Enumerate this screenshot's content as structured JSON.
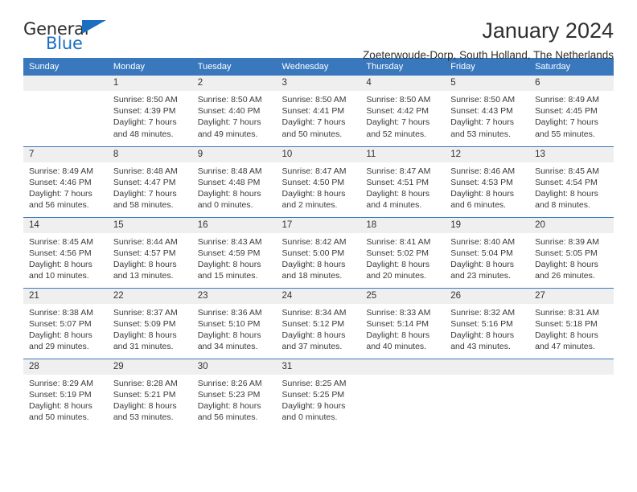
{
  "logo": {
    "word_one": "General",
    "word_two": "Blue",
    "triangle_color": "#1b6fc1",
    "text_color": "#2b2b2b"
  },
  "header": {
    "title": "January 2024",
    "subtitle": "Zoeterwoude-Dorp, South Holland, The Netherlands"
  },
  "colors": {
    "header_blue": "#3a78be",
    "daynum_band": "#efefef",
    "text": "#3a3a3a"
  },
  "weekday_headers": [
    "Sunday",
    "Monday",
    "Tuesday",
    "Wednesday",
    "Thursday",
    "Friday",
    "Saturday"
  ],
  "weeks": [
    [
      {
        "day": "",
        "sunrise": "",
        "sunset": "",
        "daylight_line1": "",
        "daylight_line2": "",
        "blank": true
      },
      {
        "day": "1",
        "sunrise": "Sunrise: 8:50 AM",
        "sunset": "Sunset: 4:39 PM",
        "daylight_line1": "Daylight: 7 hours",
        "daylight_line2": "and 48 minutes."
      },
      {
        "day": "2",
        "sunrise": "Sunrise: 8:50 AM",
        "sunset": "Sunset: 4:40 PM",
        "daylight_line1": "Daylight: 7 hours",
        "daylight_line2": "and 49 minutes."
      },
      {
        "day": "3",
        "sunrise": "Sunrise: 8:50 AM",
        "sunset": "Sunset: 4:41 PM",
        "daylight_line1": "Daylight: 7 hours",
        "daylight_line2": "and 50 minutes."
      },
      {
        "day": "4",
        "sunrise": "Sunrise: 8:50 AM",
        "sunset": "Sunset: 4:42 PM",
        "daylight_line1": "Daylight: 7 hours",
        "daylight_line2": "and 52 minutes."
      },
      {
        "day": "5",
        "sunrise": "Sunrise: 8:50 AM",
        "sunset": "Sunset: 4:43 PM",
        "daylight_line1": "Daylight: 7 hours",
        "daylight_line2": "and 53 minutes."
      },
      {
        "day": "6",
        "sunrise": "Sunrise: 8:49 AM",
        "sunset": "Sunset: 4:45 PM",
        "daylight_line1": "Daylight: 7 hours",
        "daylight_line2": "and 55 minutes."
      }
    ],
    [
      {
        "day": "7",
        "sunrise": "Sunrise: 8:49 AM",
        "sunset": "Sunset: 4:46 PM",
        "daylight_line1": "Daylight: 7 hours",
        "daylight_line2": "and 56 minutes."
      },
      {
        "day": "8",
        "sunrise": "Sunrise: 8:48 AM",
        "sunset": "Sunset: 4:47 PM",
        "daylight_line1": "Daylight: 7 hours",
        "daylight_line2": "and 58 minutes."
      },
      {
        "day": "9",
        "sunrise": "Sunrise: 8:48 AM",
        "sunset": "Sunset: 4:48 PM",
        "daylight_line1": "Daylight: 8 hours",
        "daylight_line2": "and 0 minutes."
      },
      {
        "day": "10",
        "sunrise": "Sunrise: 8:47 AM",
        "sunset": "Sunset: 4:50 PM",
        "daylight_line1": "Daylight: 8 hours",
        "daylight_line2": "and 2 minutes."
      },
      {
        "day": "11",
        "sunrise": "Sunrise: 8:47 AM",
        "sunset": "Sunset: 4:51 PM",
        "daylight_line1": "Daylight: 8 hours",
        "daylight_line2": "and 4 minutes."
      },
      {
        "day": "12",
        "sunrise": "Sunrise: 8:46 AM",
        "sunset": "Sunset: 4:53 PM",
        "daylight_line1": "Daylight: 8 hours",
        "daylight_line2": "and 6 minutes."
      },
      {
        "day": "13",
        "sunrise": "Sunrise: 8:45 AM",
        "sunset": "Sunset: 4:54 PM",
        "daylight_line1": "Daylight: 8 hours",
        "daylight_line2": "and 8 minutes."
      }
    ],
    [
      {
        "day": "14",
        "sunrise": "Sunrise: 8:45 AM",
        "sunset": "Sunset: 4:56 PM",
        "daylight_line1": "Daylight: 8 hours",
        "daylight_line2": "and 10 minutes."
      },
      {
        "day": "15",
        "sunrise": "Sunrise: 8:44 AM",
        "sunset": "Sunset: 4:57 PM",
        "daylight_line1": "Daylight: 8 hours",
        "daylight_line2": "and 13 minutes."
      },
      {
        "day": "16",
        "sunrise": "Sunrise: 8:43 AM",
        "sunset": "Sunset: 4:59 PM",
        "daylight_line1": "Daylight: 8 hours",
        "daylight_line2": "and 15 minutes."
      },
      {
        "day": "17",
        "sunrise": "Sunrise: 8:42 AM",
        "sunset": "Sunset: 5:00 PM",
        "daylight_line1": "Daylight: 8 hours",
        "daylight_line2": "and 18 minutes."
      },
      {
        "day": "18",
        "sunrise": "Sunrise: 8:41 AM",
        "sunset": "Sunset: 5:02 PM",
        "daylight_line1": "Daylight: 8 hours",
        "daylight_line2": "and 20 minutes."
      },
      {
        "day": "19",
        "sunrise": "Sunrise: 8:40 AM",
        "sunset": "Sunset: 5:04 PM",
        "daylight_line1": "Daylight: 8 hours",
        "daylight_line2": "and 23 minutes."
      },
      {
        "day": "20",
        "sunrise": "Sunrise: 8:39 AM",
        "sunset": "Sunset: 5:05 PM",
        "daylight_line1": "Daylight: 8 hours",
        "daylight_line2": "and 26 minutes."
      }
    ],
    [
      {
        "day": "21",
        "sunrise": "Sunrise: 8:38 AM",
        "sunset": "Sunset: 5:07 PM",
        "daylight_line1": "Daylight: 8 hours",
        "daylight_line2": "and 29 minutes."
      },
      {
        "day": "22",
        "sunrise": "Sunrise: 8:37 AM",
        "sunset": "Sunset: 5:09 PM",
        "daylight_line1": "Daylight: 8 hours",
        "daylight_line2": "and 31 minutes."
      },
      {
        "day": "23",
        "sunrise": "Sunrise: 8:36 AM",
        "sunset": "Sunset: 5:10 PM",
        "daylight_line1": "Daylight: 8 hours",
        "daylight_line2": "and 34 minutes."
      },
      {
        "day": "24",
        "sunrise": "Sunrise: 8:34 AM",
        "sunset": "Sunset: 5:12 PM",
        "daylight_line1": "Daylight: 8 hours",
        "daylight_line2": "and 37 minutes."
      },
      {
        "day": "25",
        "sunrise": "Sunrise: 8:33 AM",
        "sunset": "Sunset: 5:14 PM",
        "daylight_line1": "Daylight: 8 hours",
        "daylight_line2": "and 40 minutes."
      },
      {
        "day": "26",
        "sunrise": "Sunrise: 8:32 AM",
        "sunset": "Sunset: 5:16 PM",
        "daylight_line1": "Daylight: 8 hours",
        "daylight_line2": "and 43 minutes."
      },
      {
        "day": "27",
        "sunrise": "Sunrise: 8:31 AM",
        "sunset": "Sunset: 5:18 PM",
        "daylight_line1": "Daylight: 8 hours",
        "daylight_line2": "and 47 minutes."
      }
    ],
    [
      {
        "day": "28",
        "sunrise": "Sunrise: 8:29 AM",
        "sunset": "Sunset: 5:19 PM",
        "daylight_line1": "Daylight: 8 hours",
        "daylight_line2": "and 50 minutes."
      },
      {
        "day": "29",
        "sunrise": "Sunrise: 8:28 AM",
        "sunset": "Sunset: 5:21 PM",
        "daylight_line1": "Daylight: 8 hours",
        "daylight_line2": "and 53 minutes."
      },
      {
        "day": "30",
        "sunrise": "Sunrise: 8:26 AM",
        "sunset": "Sunset: 5:23 PM",
        "daylight_line1": "Daylight: 8 hours",
        "daylight_line2": "and 56 minutes."
      },
      {
        "day": "31",
        "sunrise": "Sunrise: 8:25 AM",
        "sunset": "Sunset: 5:25 PM",
        "daylight_line1": "Daylight: 9 hours",
        "daylight_line2": "and 0 minutes."
      },
      {
        "day": "",
        "sunrise": "",
        "sunset": "",
        "daylight_line1": "",
        "daylight_line2": "",
        "blank": true
      },
      {
        "day": "",
        "sunrise": "",
        "sunset": "",
        "daylight_line1": "",
        "daylight_line2": "",
        "blank": true
      },
      {
        "day": "",
        "sunrise": "",
        "sunset": "",
        "daylight_line1": "",
        "daylight_line2": "",
        "blank": true
      }
    ]
  ]
}
